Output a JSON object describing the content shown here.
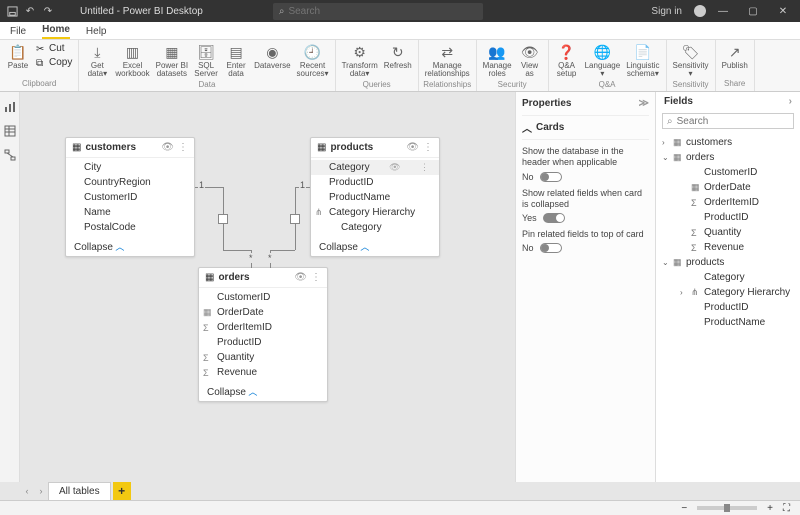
{
  "titlebar": {
    "doc_title": "Untitled - Power BI Desktop",
    "search_placeholder": "Search",
    "signin": "Sign in"
  },
  "menu": {
    "tabs": [
      "File",
      "Home",
      "Help"
    ],
    "active": 1
  },
  "ribbon": {
    "clipboard": {
      "label": "Clipboard",
      "paste": "Paste",
      "cut": "Cut",
      "copy": "Copy"
    },
    "data": {
      "label": "Data",
      "items": [
        {
          "label": "Get\ndata▾"
        },
        {
          "label": "Excel\nworkbook"
        },
        {
          "label": "Power BI\ndatasets"
        },
        {
          "label": "SQL\nServer"
        },
        {
          "label": "Enter\ndata"
        },
        {
          "label": "Dataverse"
        },
        {
          "label": "Recent\nsources▾"
        }
      ]
    },
    "queries": {
      "label": "Queries",
      "items": [
        {
          "label": "Transform\ndata▾"
        },
        {
          "label": "Refresh"
        }
      ]
    },
    "relationships": {
      "label": "Relationships",
      "items": [
        {
          "label": "Manage\nrelationships"
        }
      ]
    },
    "security": {
      "label": "Security",
      "items": [
        {
          "label": "Manage\nroles"
        },
        {
          "label": "View\nas"
        }
      ]
    },
    "qa": {
      "label": "Q&A",
      "items": [
        {
          "label": "Q&A\nsetup"
        },
        {
          "label": "Language\n▾"
        },
        {
          "label": "Linguistic\nschema▾"
        }
      ]
    },
    "sensitivity": {
      "label": "Sensitivity",
      "items": [
        {
          "label": "Sensitivity\n▾"
        }
      ]
    },
    "share": {
      "label": "Share",
      "items": [
        {
          "label": "Publish"
        }
      ]
    }
  },
  "canvas": {
    "customers": {
      "name": "customers",
      "fields": [
        "City",
        "CountryRegion",
        "CustomerID",
        "Name",
        "PostalCode"
      ],
      "collapse": "Collapse"
    },
    "products": {
      "name": "products",
      "fields": [
        {
          "label": "Category",
          "selected": true
        },
        {
          "label": "ProductID"
        },
        {
          "label": "ProductName"
        },
        {
          "label": "Category Hierarchy",
          "icon": "hierarchy"
        },
        {
          "label": "Category",
          "indent": true
        }
      ],
      "collapse": "Collapse"
    },
    "orders": {
      "name": "orders",
      "fields": [
        {
          "label": "CustomerID"
        },
        {
          "label": "OrderDate",
          "icon": "calendar"
        },
        {
          "label": "OrderItemID",
          "icon": "sigma"
        },
        {
          "label": "ProductID"
        },
        {
          "label": "Quantity",
          "icon": "sigma"
        },
        {
          "label": "Revenue",
          "icon": "sigma"
        }
      ],
      "collapse": "Collapse"
    },
    "rel": {
      "one": "1",
      "many": "*"
    }
  },
  "properties": {
    "title": "Properties",
    "cards": "Cards",
    "opt1_label": "Show the database in the header when applicable",
    "opt1_state": "No",
    "opt1_on": false,
    "opt2_label": "Show related fields when card is collapsed",
    "opt2_state": "Yes",
    "opt2_on": true,
    "opt3_label": "Pin related fields to top of card",
    "opt3_state": "No",
    "opt3_on": false
  },
  "fields": {
    "title": "Fields",
    "search_placeholder": "Search",
    "tree": [
      {
        "type": "table",
        "label": "customers",
        "expand": ">"
      },
      {
        "type": "table",
        "label": "orders",
        "expand": "v"
      },
      {
        "type": "field",
        "label": "CustomerID"
      },
      {
        "type": "field",
        "label": "OrderDate",
        "icon": "calendar"
      },
      {
        "type": "field",
        "label": "OrderItemID",
        "icon": "sigma"
      },
      {
        "type": "field",
        "label": "ProductID"
      },
      {
        "type": "field",
        "label": "Quantity",
        "icon": "sigma"
      },
      {
        "type": "field",
        "label": "Revenue",
        "icon": "sigma"
      },
      {
        "type": "table",
        "label": "products",
        "expand": "v"
      },
      {
        "type": "field",
        "label": "Category"
      },
      {
        "type": "hier",
        "label": "Category Hierarchy",
        "expand": ">"
      },
      {
        "type": "field",
        "label": "ProductID"
      },
      {
        "type": "field",
        "label": "ProductName"
      }
    ]
  },
  "bottom": {
    "tab": "All tables"
  }
}
